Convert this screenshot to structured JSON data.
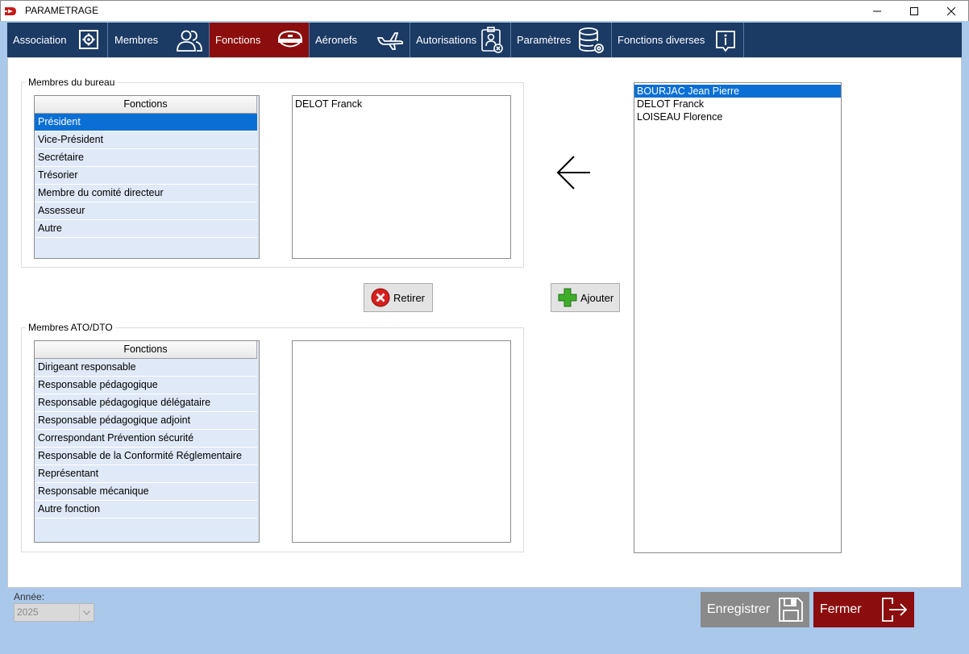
{
  "window": {
    "title": "PARAMETRAGE",
    "icon": "app-logo-icon"
  },
  "nav": {
    "tabs": [
      {
        "label": "Association",
        "icon": "gear-icon"
      },
      {
        "label": "Membres",
        "icon": "users-icon"
      },
      {
        "label": "Fonctions",
        "icon": "pilot-cap-icon",
        "active": true
      },
      {
        "label": "Aéronefs",
        "icon": "airplane-icon"
      },
      {
        "label": "Autorisations",
        "icon": "badge-icon"
      },
      {
        "label": "Paramètres",
        "icon": "database-gear-icon"
      },
      {
        "label": "Fonctions diverses",
        "icon": "info-icon"
      }
    ]
  },
  "bureau": {
    "group_label": "Membres du bureau",
    "grid_header": "Fonctions",
    "functions": [
      "Président",
      "Vice-Président",
      "Secrétaire",
      "Trésorier",
      "Membre du comité directeur",
      "Assesseur",
      "Autre"
    ],
    "selected_index": 0,
    "assigned_members": [
      "DELOT Franck"
    ]
  },
  "ato": {
    "group_label": "Membres ATO/DTO",
    "grid_header": "Fonctions",
    "functions": [
      "Dirigeant responsable",
      "Responsable pédagogique",
      "Responsable pédagogique délégataire",
      "Responsable pédagogique adjoint",
      "Correspondant Prévention sécurité",
      "Responsable de la Conformité Réglementaire",
      "Représentant",
      "Responsable mécanique",
      "Autre fonction"
    ],
    "assigned_members": []
  },
  "actions": {
    "remove_label": "Retirer",
    "add_label": "Ajouter"
  },
  "members_list": {
    "items": [
      "BOURJAC Jean Pierre",
      "DELOT Franck",
      "LOISEAU Florence"
    ],
    "selected_index": 0
  },
  "footer": {
    "year_label": "Année:",
    "year_value": "2025",
    "save_label": "Enregistrer",
    "close_label": "Fermer"
  },
  "colors": {
    "nav_bg": "#1b3a64",
    "active_tab": "#8b0d0d",
    "selection": "#0a6fd4",
    "close_button": "#8b0d0d",
    "save_button": "#8a8a8a"
  }
}
